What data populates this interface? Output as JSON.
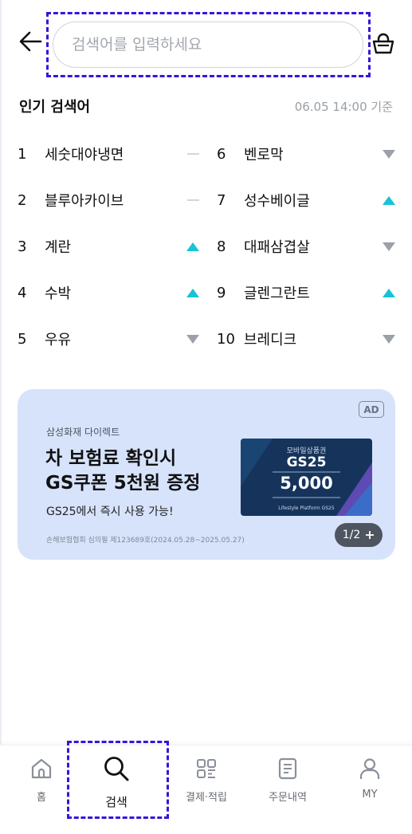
{
  "search": {
    "placeholder": "검색어를 입력하세요"
  },
  "popular": {
    "title": "인기 검색어",
    "timestamp": "06.05 14:00 기준",
    "left": [
      {
        "rank": "1",
        "keyword": "세숫대야냉면",
        "trend": "same"
      },
      {
        "rank": "2",
        "keyword": "블루아카이브",
        "trend": "same"
      },
      {
        "rank": "3",
        "keyword": "계란",
        "trend": "up"
      },
      {
        "rank": "4",
        "keyword": "수박",
        "trend": "up"
      },
      {
        "rank": "5",
        "keyword": "우유",
        "trend": "down"
      }
    ],
    "right": [
      {
        "rank": "6",
        "keyword": "벤로막",
        "trend": "down"
      },
      {
        "rank": "7",
        "keyword": "성수베이글",
        "trend": "up"
      },
      {
        "rank": "8",
        "keyword": "대패삼겹살",
        "trend": "down"
      },
      {
        "rank": "9",
        "keyword": "글렌그란트",
        "trend": "up"
      },
      {
        "rank": "10",
        "keyword": "브레디크",
        "trend": "down"
      }
    ]
  },
  "ad": {
    "badge": "AD",
    "brand": "삼성화재 다이렉트",
    "title": "차 보험료 확인시\nGS쿠폰 5천원 증정",
    "subtitle": "GS25에서 즉시 사용 가능!",
    "note": "손해보험협회 심의필 제123689호(2024.05.28~2025.05.27)",
    "pager": "1/2",
    "coupon": {
      "header": "모바일상품권",
      "brand": "GS25",
      "amount": "5,000",
      "footer": "Lifestyle Platform  GS25"
    },
    "colors": {
      "background": "#d7e3fb",
      "coupon": "#16345b"
    }
  },
  "bottom_nav": [
    {
      "label": "홈",
      "icon": "home-icon"
    },
    {
      "label": "검색",
      "icon": "search-icon",
      "active": true
    },
    {
      "label": "결제·적립",
      "icon": "pay-grid-icon"
    },
    {
      "label": "주문내역",
      "icon": "order-list-icon"
    },
    {
      "label": "MY",
      "icon": "person-icon"
    }
  ],
  "colors": {
    "trend_up": "#17c3d6",
    "trend_down": "#9ca1a8",
    "highlight": "#3a14d8"
  }
}
